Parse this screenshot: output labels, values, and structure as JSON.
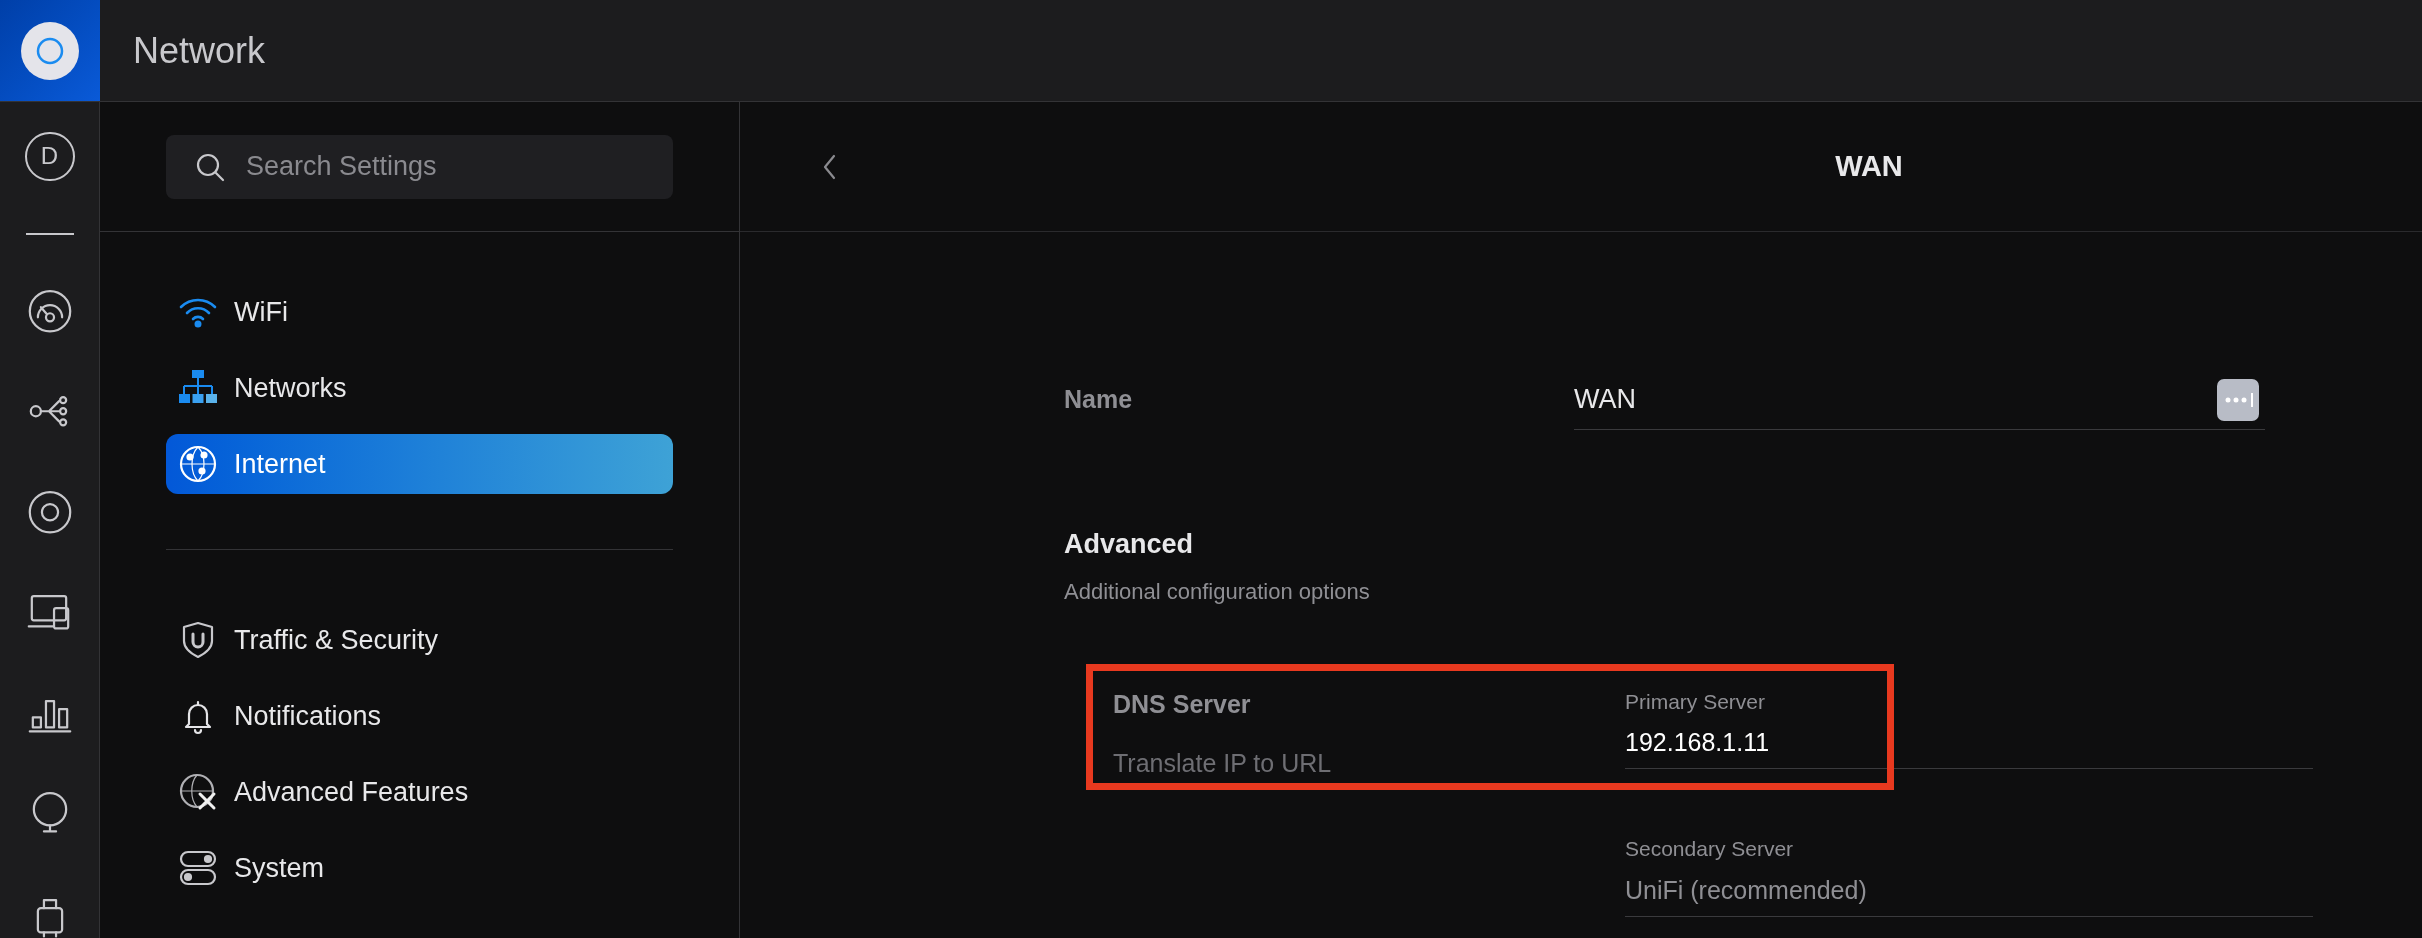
{
  "app": {
    "title": "Network"
  },
  "rail": {
    "avatar": "D"
  },
  "search": {
    "placeholder": "Search Settings"
  },
  "sidebar": {
    "groups": [
      {
        "items": [
          {
            "label": "WiFi",
            "selected": false
          },
          {
            "label": "Networks",
            "selected": false
          },
          {
            "label": "Internet",
            "selected": true
          }
        ]
      },
      {
        "items": [
          {
            "label": "Traffic & Security",
            "selected": false
          },
          {
            "label": "Notifications",
            "selected": false
          },
          {
            "label": "Advanced Features",
            "selected": false
          },
          {
            "label": "System",
            "selected": false
          }
        ]
      }
    ]
  },
  "page": {
    "title": "WAN"
  },
  "name_field": {
    "label": "Name",
    "value": "WAN"
  },
  "advanced": {
    "title": "Advanced",
    "subtitle": "Additional configuration options"
  },
  "dns": {
    "title": "DNS Server",
    "description": "Translate IP to URL",
    "highlighted": true,
    "fields": [
      {
        "label": "Primary Server",
        "value": "192.168.1.11"
      },
      {
        "label": "Secondary Server",
        "placeholder": "UniFi (recommended)"
      }
    ]
  }
}
